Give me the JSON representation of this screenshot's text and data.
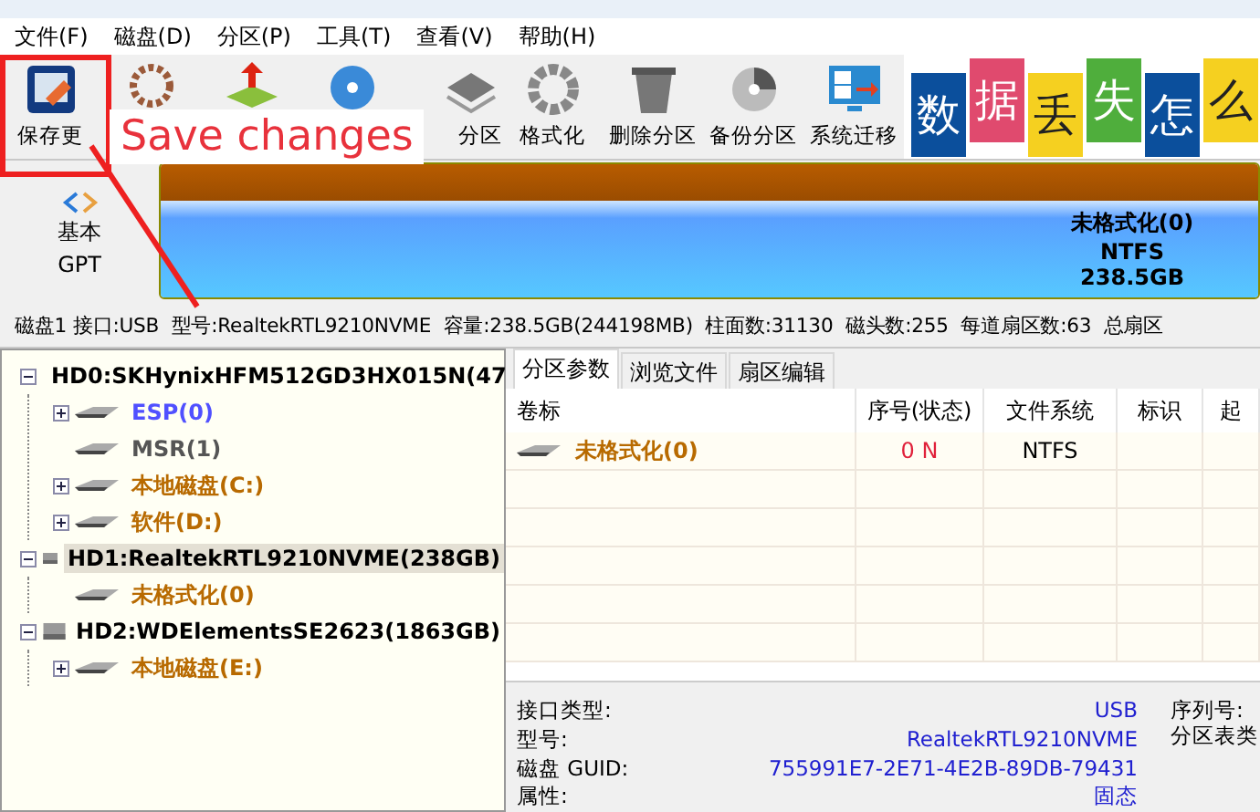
{
  "menu": [
    "文件(F)",
    "磁盘(D)",
    "分区(P)",
    "工具(T)",
    "查看(V)",
    "帮助(H)"
  ],
  "toolbar": [
    {
      "kind": "labeled",
      "label": "保存更"
    },
    {
      "kind": "icon_only"
    },
    {
      "kind": "icon_only"
    },
    {
      "kind": "icon_only"
    },
    {
      "kind": "cut_label",
      "label": "分区"
    },
    {
      "kind": "labeled",
      "label": "格式化"
    },
    {
      "kind": "labeled",
      "label": "删除分区"
    },
    {
      "kind": "labeled",
      "label": "备份分区"
    },
    {
      "kind": "labeled",
      "label": "系统迁移"
    }
  ],
  "banner": [
    {
      "text": "数",
      "color": "#0b4f9c"
    },
    {
      "text": "据",
      "color": "#e04a6e"
    },
    {
      "text": "丢",
      "color": "#f5d020"
    },
    {
      "text": "失",
      "color": "#4fae3c"
    },
    {
      "text": "怎",
      "color": "#0b4f9c"
    },
    {
      "text": "么",
      "color": "#f5d020"
    }
  ],
  "disk_map": {
    "type_line1": "基本",
    "type_line2": "GPT",
    "partition": {
      "name": "未格式化(0)",
      "fs": "NTFS",
      "size": "238.5GB"
    }
  },
  "disk_info": "磁盘1 接口:USB  型号:RealtekRTL9210NVME  容量:238.5GB(244198MB)  柱面数:31130  磁头数:255  每道扇区数:63  总扇区",
  "tree": [
    {
      "label": "HD0:SKHynixHFM512GD3HX015N(47",
      "kind": "disk",
      "expandable": true,
      "expanded": true,
      "selected": false,
      "children": [
        {
          "label": "ESP(0)",
          "kind": "partition",
          "expandable": true,
          "expanded": false,
          "selected": false,
          "color": "#5050ff"
        },
        {
          "label": "MSR(1)",
          "kind": "partition",
          "expandable": false,
          "selected": false,
          "color": "#555555"
        },
        {
          "label": "本地磁盘(C:)",
          "kind": "partition",
          "expandable": true,
          "expanded": false,
          "selected": false,
          "color": "#b86a00"
        },
        {
          "label": "软件(D:)",
          "kind": "partition",
          "expandable": true,
          "expanded": false,
          "selected": false,
          "color": "#b86a00"
        }
      ]
    },
    {
      "label": "HD1:RealtekRTL9210NVME(238GB)",
      "kind": "disk",
      "expandable": true,
      "expanded": true,
      "selected": true,
      "children": [
        {
          "label": "未格式化(0)",
          "kind": "partition",
          "expandable": false,
          "selected": false,
          "color": "#b86a00"
        }
      ]
    },
    {
      "label": "HD2:WDElementsSE2623(1863GB)",
      "kind": "disk",
      "expandable": true,
      "expanded": true,
      "selected": false,
      "children": [
        {
          "label": "本地磁盘(E:)",
          "kind": "partition",
          "expandable": true,
          "expanded": false,
          "selected": false,
          "color": "#b86a00"
        }
      ]
    }
  ],
  "tabs": [
    {
      "label": "分区参数",
      "selected": true
    },
    {
      "label": "浏览文件",
      "selected": false
    },
    {
      "label": "扇区编辑",
      "selected": false
    }
  ],
  "table": {
    "columns": [
      "卷标",
      "序号(状态)",
      "文件系统",
      "标识",
      "起"
    ],
    "rows": [
      {
        "volume": "未格式化(0)",
        "index": "0 N",
        "fs": "NTFS"
      }
    ]
  },
  "details": {
    "left": [
      {
        "label": "接口类型:",
        "value": "USB"
      },
      {
        "label": "型号:",
        "value": "RealtekRTL9210NVME"
      },
      {
        "label": "磁盘 GUID:",
        "value": "755991E7-2E71-4E2B-89DB-79431"
      },
      {
        "label": "属性:",
        "value": "固态"
      }
    ],
    "right": [
      "序列号:",
      "分区表类"
    ]
  },
  "annotation": {
    "text": "Save changes"
  }
}
